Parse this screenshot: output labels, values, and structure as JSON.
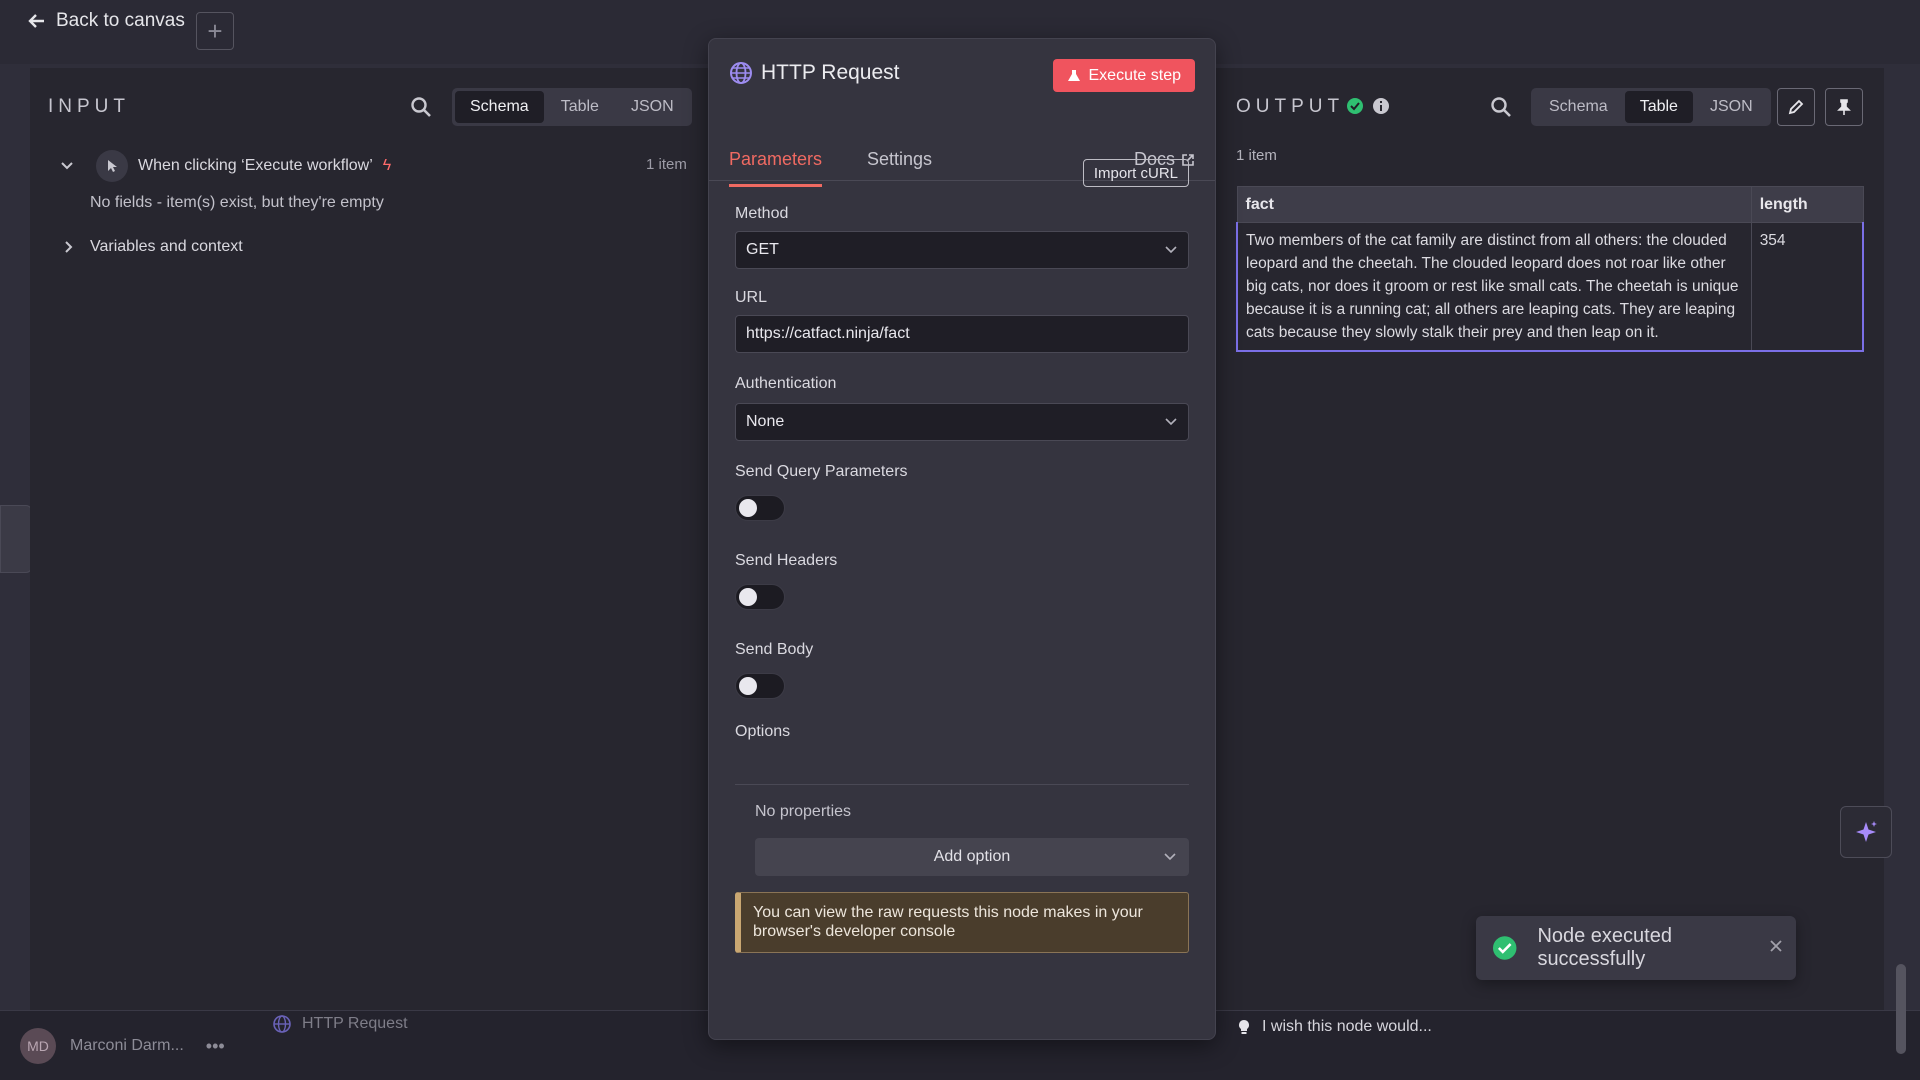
{
  "nav": {
    "back_label": "Back to canvas",
    "add_symbol": "+"
  },
  "footer": {
    "user_initials": "MD",
    "user_name": "Marconi Darm...",
    "more_label": "•••",
    "node_label": "HTTP Request"
  },
  "input": {
    "title": "INPUT",
    "view_tabs": [
      "Schema",
      "Table",
      "JSON"
    ],
    "active_view": "Schema",
    "trigger_label": "When clicking ‘Execute workflow’",
    "trigger_count": "1 item",
    "empty_text": "No fields - item(s) exist, but they're empty",
    "variables_label": "Variables and context"
  },
  "node": {
    "title": "HTTP Request",
    "execute_label": "Execute step",
    "tabs": [
      "Parameters",
      "Settings"
    ],
    "active_tab": "Parameters",
    "docs_label": "Docs",
    "import_label": "Import cURL",
    "method_label": "Method",
    "method_value": "GET",
    "url_label": "URL",
    "url_value": "https://catfact.ninja/fact",
    "auth_label": "Authentication",
    "auth_value": "None",
    "query_label": "Send Query Parameters",
    "headers_label": "Send Headers",
    "body_label": "Send Body",
    "options_label": "Options",
    "no_props": "No properties",
    "add_option": "Add option",
    "notice": "You can view the raw requests this node makes in your browser's developer console"
  },
  "output": {
    "title": "OUTPUT",
    "view_tabs": [
      "Schema",
      "Table",
      "JSON"
    ],
    "active_view": "Table",
    "count": "1 item",
    "columns": [
      "fact",
      "length"
    ],
    "rows": [
      [
        "Two members of the cat family are distinct from all others: the clouded leopard and the cheetah. The clouded leopard does not roar like other big cats, nor does it groom or rest like small cats. The cheetah is unique because it is a running cat; all others are leaping cats. They are leaping cats because they slowly stalk their prey and then leap on it.",
        "354"
      ]
    ],
    "wish_label": "I wish this node would..."
  },
  "toast": {
    "message": "Node executed successfully"
  },
  "colors": {
    "accent": "#f06a62",
    "success": "#2fbf71",
    "selection": "#7b6fe6",
    "notice_bg": "#4a3d2c"
  }
}
